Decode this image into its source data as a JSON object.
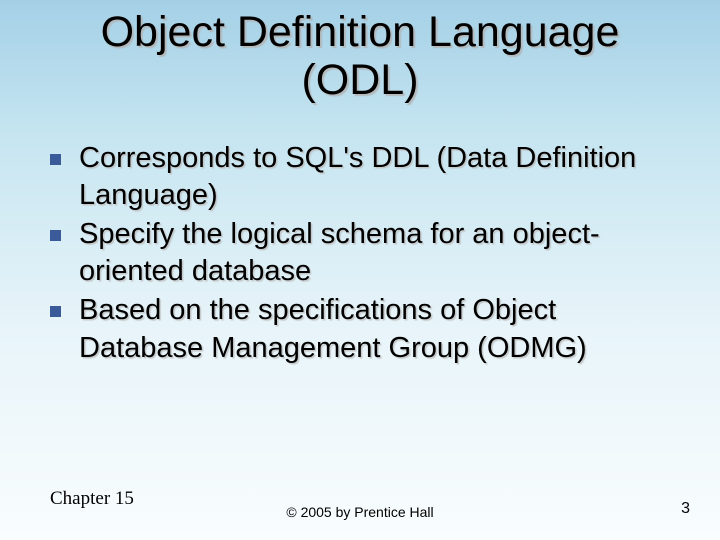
{
  "title_line1": "Object Definition Language",
  "title_line2": "(ODL)",
  "bullets": [
    "Corresponds to SQL's DDL (Data Definition Language)",
    "Specify the logical schema for an object-oriented database",
    "Based on the specifications of Object Database Management Group (ODMG)"
  ],
  "footer": {
    "left": "Chapter 15",
    "center": "© 2005 by Prentice Hall",
    "right": "3"
  }
}
